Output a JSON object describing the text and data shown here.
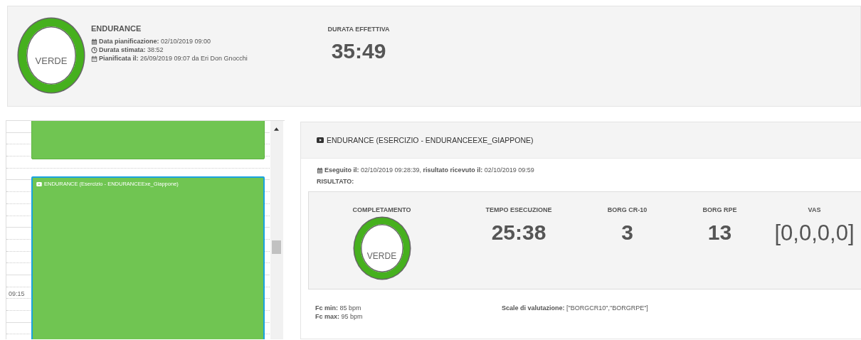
{
  "plan": {
    "status": {
      "label": "VERDE",
      "color": "#46b01e"
    },
    "title": "ENDURANCE",
    "details": [
      {
        "kind": "calendar",
        "text": "**Data pianificazione:** 02/10/2019 09:00"
      },
      {
        "kind": "clock",
        "text": "**Durata stimata:** 38:52"
      },
      {
        "kind": "calendar-outline",
        "text": "**Pianificata il:** 26/09/2019 09:07 da Eri Don Gnocchi"
      }
    ],
    "duration": {
      "label": "DURATA EFFETTIVA",
      "value": "35:49"
    }
  },
  "calendar": {
    "time_label": "09:15",
    "events": [
      {
        "selected": false
      },
      {
        "selected": true,
        "title": "ENDURANCE (Esercizio - ENDURANCEExe_Giappone)"
      }
    ]
  },
  "result": {
    "title": "ENDURANCE (ESERCIZIO - ENDURANCEEXE_GIAPPONE)",
    "executed": "**Eseguito il:** 02/10/2019 09:28:39, **risultato ricevuto il:** 02/10/2019 09:59",
    "result_label": "RISULTATO:",
    "metrics": [
      {
        "kind": "ring",
        "label": "COMPLETAMENTO",
        "value": "VERDE",
        "color": "#46b01e"
      },
      {
        "kind": "value",
        "label": "TEMPO ESECUZIONE",
        "value": "25:38"
      },
      {
        "kind": "value",
        "label": "BORG CR-10",
        "value": "3"
      },
      {
        "kind": "value",
        "label": "BORG RPE",
        "value": "13"
      },
      {
        "kind": "value",
        "label": "VAS",
        "value": "[0,0,0,0]"
      }
    ],
    "heart_rate": [
      "**Fc min:** 85 bpm",
      "**Fc max:** 95 bpm"
    ],
    "scales": "**Scale di valutazione:** [\"BORGCR10\",\"BORGRPE\"]"
  }
}
